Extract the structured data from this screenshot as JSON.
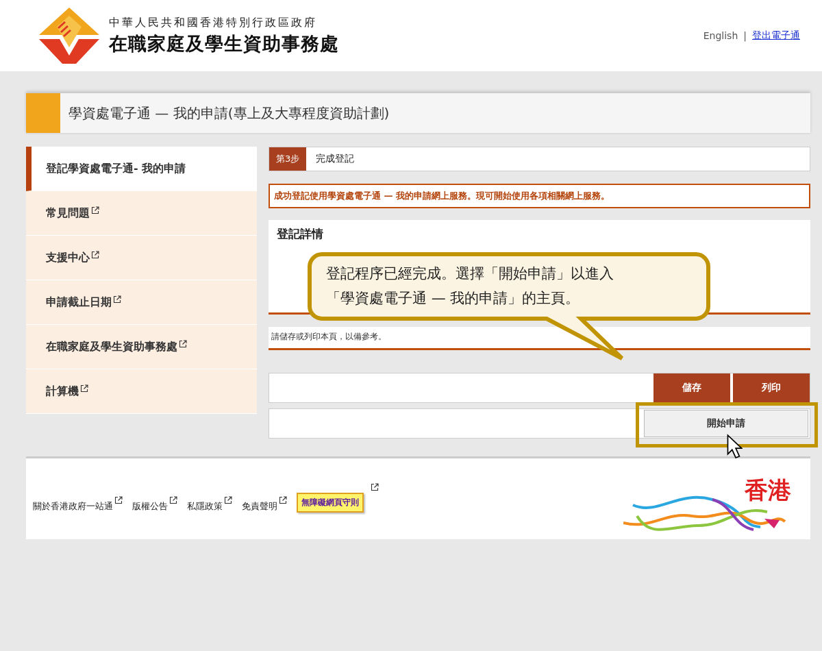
{
  "header": {
    "agency_line1": "中華人民共和國香港特別行政區政府",
    "agency_name": "在職家庭及學生資助事務處",
    "links": [
      {
        "label": "English"
      },
      {
        "label": "登出電子通"
      }
    ],
    "separator": "|"
  },
  "page_title": "學資處電子通 — 我的申請(專上及大專程度資助計劃)",
  "sidebar": {
    "items": [
      {
        "label": "登記學資處電子通- 我的申請",
        "selected": true,
        "external": false
      },
      {
        "label": "常見問題",
        "selected": false,
        "external": true
      },
      {
        "label": "支援中心",
        "selected": false,
        "external": true
      },
      {
        "label": "申請截止日期",
        "selected": false,
        "external": true
      },
      {
        "label": "在職家庭及學生資助事務處",
        "selected": false,
        "external": true
      },
      {
        "label": "計算機",
        "selected": false,
        "external": true
      }
    ]
  },
  "step": {
    "badge": "第3步",
    "label": "完成登記"
  },
  "success_message": "成功登記使用學資處電子通 — 我的申請網上服務。現可開始使用各項相關網上服務。",
  "details": {
    "heading": "登記詳情"
  },
  "note": "請儲存或列印本頁，以備參考。",
  "actions": [
    {
      "label": "儲存",
      "kind": "primary"
    },
    {
      "label": "列印",
      "kind": "primary"
    }
  ],
  "start_button": {
    "label": "開始申請",
    "highlighted": true
  },
  "callout": {
    "lines": [
      "登記程序已經完成。選擇「開始申請」以進入",
      "「學資處電子通 — 我的申請」的主頁。"
    ]
  },
  "footer": {
    "links": [
      {
        "label": "關於香港政府一站通",
        "highlighted": false
      },
      {
        "label": "版權公告",
        "highlighted": false
      },
      {
        "label": "私隱政策",
        "highlighted": false
      },
      {
        "label": "免責聲明",
        "highlighted": false
      },
      {
        "label": "無障礙網頁守則",
        "highlighted": true
      }
    ],
    "brand": "香港"
  }
}
